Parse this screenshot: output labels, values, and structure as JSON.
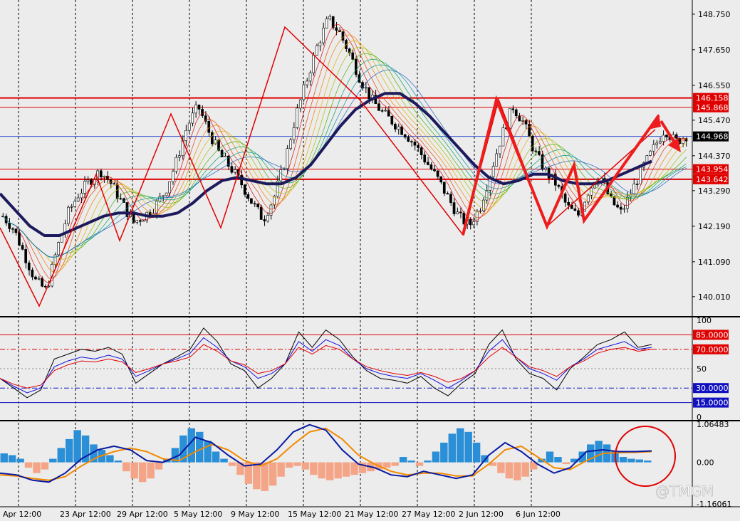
{
  "watermark": "@TMGM",
  "colors": {
    "background": "#ececec",
    "grid": "#000000",
    "bull": "#ffffff",
    "bear": "#000000",
    "level_red": "#e00000",
    "ma_navy": "#1c1a5c",
    "hist_up": "#2a8fd6",
    "hist_down": "#f4a587",
    "signal_orange": "#f28a00",
    "current_price_bg": "#000000"
  },
  "chart_data": {
    "type": "candlestick",
    "symbol_timeframe": "",
    "time_axis": {
      "labels": [
        "Apr 12:00",
        "23 Apr 12:00",
        "29 Apr 12:00",
        "5 May 12:00",
        "9 May 12:00",
        "15 May 12:00",
        "21 May 12:00",
        "27 May 12:00",
        "2 Jun 12:00",
        "6 Jun 12:00"
      ]
    },
    "price_panel": {
      "yticks": [
        "148.750",
        "147.650",
        "146.550",
        "145.470",
        "144.370",
        "143.290",
        "142.190",
        "141.090",
        "140.010"
      ],
      "ylim": [
        139.5,
        149.1
      ],
      "current_price": "144.968",
      "levels": [
        {
          "label": "146.158",
          "value": 146.158,
          "style": "thick"
        },
        {
          "label": "145.868",
          "value": 145.868,
          "style": "thin"
        },
        {
          "label": "143.954",
          "value": 143.954,
          "style": "thin"
        },
        {
          "label": "143.642",
          "value": 143.642,
          "style": "thick"
        }
      ],
      "close_path": [
        142.5,
        142.1,
        141.3,
        140.5,
        140.2,
        141.5,
        142.6,
        143.2,
        143.6,
        143.9,
        143.5,
        142.9,
        142.3,
        142.5,
        142.8,
        143.3,
        144.2,
        145.3,
        145.9,
        145.1,
        144.4,
        144.0,
        143.5,
        142.9,
        142.4,
        143.1,
        144.2,
        145.6,
        146.7,
        147.8,
        148.6,
        148.2,
        147.5,
        146.7,
        146.1,
        145.7,
        145.4,
        145.1,
        144.7,
        144.2,
        143.7,
        143.1,
        142.5,
        142.2,
        142.8,
        143.9,
        145.0,
        145.9,
        145.4,
        144.5,
        143.9,
        143.5,
        142.8,
        142.5,
        143.3,
        143.8,
        143.0,
        142.6,
        143.3,
        144.0,
        144.6,
        145.2,
        144.8,
        145.0
      ],
      "ma_thick_path": [
        143.2,
        142.7,
        142.2,
        141.9,
        141.9,
        142.1,
        142.3,
        142.5,
        142.6,
        142.6,
        142.5,
        142.5,
        142.6,
        142.9,
        143.3,
        143.6,
        143.7,
        143.6,
        143.5,
        143.5,
        143.7,
        144.1,
        144.7,
        145.3,
        145.8,
        146.1,
        146.3,
        146.3,
        146.0,
        145.6,
        145.1,
        144.6,
        144.1,
        143.7,
        143.5,
        143.6,
        143.8,
        143.8,
        143.6,
        143.5,
        143.5,
        143.6,
        143.8,
        144.0,
        144.2
      ]
    },
    "oscillator_panel": {
      "yticks": [
        "100",
        "50",
        "0"
      ],
      "ylim": [
        0,
        100
      ],
      "levels": [
        {
          "label": "85.0000",
          "value": 85,
          "color": "#e00000",
          "dash": false
        },
        {
          "label": "70.0000",
          "value": 70,
          "color": "#e00000",
          "dash": true
        },
        {
          "label": "50",
          "value": 50,
          "color": "#888888",
          "dash": true
        },
        {
          "label": "30.0000",
          "value": 30,
          "color": "#1010c0",
          "dash": true
        },
        {
          "label": "15.0000",
          "value": 15,
          "color": "#1010c0",
          "dash": false
        }
      ],
      "series": [
        {
          "color": "#000000",
          "values": [
            40,
            30,
            20,
            28,
            60,
            65,
            70,
            68,
            72,
            65,
            35,
            45,
            55,
            62,
            70,
            92,
            78,
            55,
            48,
            30,
            40,
            55,
            88,
            72,
            90,
            80,
            62,
            48,
            40,
            38,
            35,
            42,
            30,
            22,
            35,
            45,
            75,
            90,
            60,
            45,
            40,
            28,
            50,
            62,
            75,
            80,
            88,
            72,
            75
          ]
        },
        {
          "color": "#1010e0",
          "values": [
            40,
            32,
            25,
            30,
            52,
            58,
            62,
            60,
            64,
            60,
            42,
            48,
            55,
            60,
            66,
            82,
            72,
            58,
            52,
            40,
            45,
            55,
            78,
            68,
            80,
            74,
            60,
            50,
            45,
            42,
            40,
            45,
            38,
            30,
            38,
            48,
            68,
            80,
            62,
            50,
            45,
            38,
            52,
            60,
            70,
            74,
            78,
            70,
            72
          ]
        },
        {
          "color": "#e00000",
          "values": [
            40,
            34,
            30,
            33,
            48,
            54,
            58,
            57,
            60,
            57,
            46,
            50,
            55,
            58,
            62,
            75,
            68,
            58,
            54,
            45,
            48,
            55,
            72,
            65,
            74,
            70,
            60,
            52,
            48,
            45,
            43,
            46,
            42,
            36,
            40,
            48,
            62,
            72,
            62,
            52,
            48,
            42,
            52,
            58,
            66,
            70,
            72,
            68,
            70
          ]
        }
      ]
    },
    "macd_panel": {
      "yticks": [
        "1.06483",
        "0.00",
        "-1.16061"
      ],
      "ylim": [
        -1.16061,
        1.06483
      ],
      "histogram": [
        0.25,
        0.2,
        0.1,
        -0.15,
        -0.3,
        -0.2,
        0.1,
        0.4,
        0.65,
        0.9,
        0.75,
        0.5,
        0.35,
        0.2,
        0.05,
        -0.25,
        -0.45,
        -0.55,
        -0.45,
        -0.2,
        0.1,
        0.4,
        0.75,
        0.95,
        0.85,
        0.6,
        0.3,
        0.1,
        -0.1,
        -0.35,
        -0.6,
        -0.75,
        -0.8,
        -0.65,
        -0.4,
        -0.15,
        -0.1,
        -0.2,
        -0.35,
        -0.45,
        -0.5,
        -0.45,
        -0.4,
        -0.35,
        -0.3,
        -0.25,
        -0.2,
        -0.15,
        -0.1,
        0.15,
        0.05,
        -0.1,
        0.05,
        0.3,
        0.55,
        0.8,
        0.95,
        0.85,
        0.55,
        0.2,
        -0.1,
        -0.3,
        -0.45,
        -0.5,
        -0.4,
        -0.2,
        0.1,
        0.3,
        0.15,
        -0.05,
        0.1,
        0.3,
        0.5,
        0.6,
        0.5,
        0.3,
        0.15,
        0.1,
        0.08,
        0.05
      ],
      "macd_line": [
        -0.3,
        -0.35,
        -0.5,
        -0.55,
        -0.3,
        0.1,
        0.35,
        0.45,
        0.35,
        0.05,
        0.0,
        0.2,
        0.7,
        0.55,
        0.2,
        -0.1,
        -0.05,
        0.35,
        0.85,
        1.05,
        0.9,
        0.35,
        -0.05,
        -0.15,
        -0.35,
        -0.4,
        -0.25,
        -0.35,
        -0.45,
        -0.35,
        0.2,
        0.55,
        0.3,
        -0.05,
        -0.3,
        -0.15,
        0.3,
        0.35,
        0.3,
        0.3,
        0.32
      ],
      "signal_line": [
        -0.35,
        -0.38,
        -0.45,
        -0.5,
        -0.4,
        -0.1,
        0.15,
        0.3,
        0.4,
        0.3,
        0.1,
        0.05,
        0.3,
        0.5,
        0.35,
        0.05,
        -0.1,
        0.1,
        0.5,
        0.85,
        0.95,
        0.65,
        0.2,
        -0.05,
        -0.25,
        -0.35,
        -0.3,
        -0.3,
        -0.38,
        -0.38,
        -0.05,
        0.35,
        0.45,
        0.15,
        -0.15,
        -0.2,
        0.05,
        0.25,
        0.27,
        0.28,
        0.3
      ]
    }
  }
}
